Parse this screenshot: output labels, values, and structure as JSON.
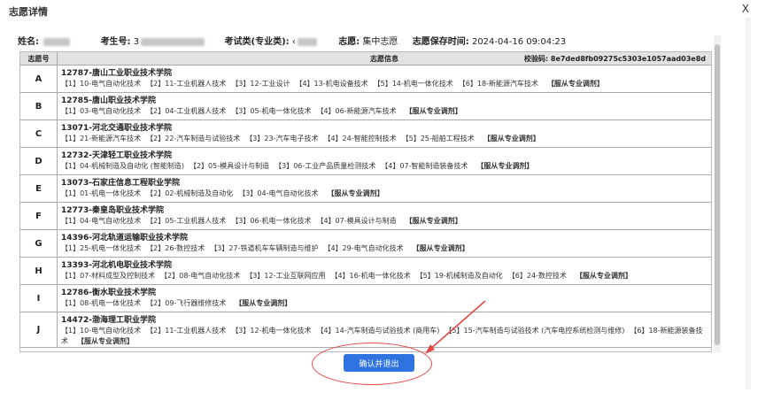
{
  "dialog": {
    "title": "志愿详情",
    "close_label": "X"
  },
  "info": {
    "name_label": "姓名:",
    "exam_no_label": "考生号:",
    "exam_no_partial": "3",
    "category_label": "考试类(专业类):",
    "category_partial": "‹",
    "mode_label": "志愿:",
    "mode_value": "集中志愿",
    "saved_label": "志愿保存时间:",
    "saved_value": "2024-04-16 09:04:23"
  },
  "table": {
    "col_no": "志愿号",
    "col_info": "志愿信息",
    "checksum_label": "校验码:",
    "checksum_value": "8e7ded8fb09275c5303e1057aad03e8d",
    "rows": [
      {
        "no": "A",
        "school": "12787-唐山工业职业技术学院",
        "majors": [
          "【1】10-电气自动化技术",
          "【2】11-工业机器人技术",
          "【3】12-工业设计",
          "【4】13-机电设备技术",
          "【5】14-机电一体化技术",
          "【6】18-新能源汽车技术"
        ],
        "adjust": "【服从专业调剂】"
      },
      {
        "no": "B",
        "school": "12785-唐山职业技术学院",
        "majors": [
          "【1】03-电气自动化技术",
          "【2】04-工业机器人技术",
          "【3】05-机电一体化技术",
          "【4】06-新能源汽车技术"
        ],
        "adjust": "【服从专业调剂】"
      },
      {
        "no": "C",
        "school": "13071-河北交通职业技术学院",
        "majors": [
          "【1】21-新能源汽车技术",
          "【2】22-汽车制造与试验技术",
          "【3】23-汽车电子技术",
          "【4】24-智能控制技术",
          "【5】25-船舶工程技术"
        ],
        "adjust": "【服从专业调剂】"
      },
      {
        "no": "D",
        "school": "12732-天津轻工职业技术学院",
        "majors": [
          "【1】04-机械制造及自动化 (智能制造)",
          "【2】05-模具设计与制造",
          "【3】06-工业产品质量检测技术",
          "【4】07-智能制造装备技术"
        ],
        "adjust": "【服从专业调剂】"
      },
      {
        "no": "E",
        "school": "13073-石家庄信息工程职业学院",
        "majors": [
          "【1】01-机电一体化技术",
          "【2】02-机械制造及自动化",
          "【3】04-电气自动化技术"
        ],
        "adjust": "【服从专业调剂】"
      },
      {
        "no": "F",
        "school": "12773-秦皇岛职业技术学院",
        "majors": [
          "【1】04-电气自动化技术",
          "【2】05-工业机器人技术",
          "【3】06-机电一体化技术",
          "【4】07-模具设计与制造"
        ],
        "adjust": "【服从专业调剂】"
      },
      {
        "no": "G",
        "school": "14396-河北轨道运输职业技术学院",
        "majors": [
          "【1】25-机电一体化技术",
          "【2】26-数控技术",
          "【3】27-铁道机车车辆制造与维护",
          "【4】29-电气自动化技术"
        ],
        "adjust": "【服从专业调剂】"
      },
      {
        "no": "H",
        "school": "13393-河北机电职业技术学院",
        "majors": [
          "【1】07-材料成型及控制技术",
          "【2】08-电气自动化技术",
          "【3】12-工业互联网应用",
          "【4】16-机电一体化技术",
          "【5】19-机械制造及自动化",
          "【6】24-数控技术"
        ],
        "adjust": "【服从专业调剂】"
      },
      {
        "no": "I",
        "school": "12786-衡水职业技术学院",
        "majors": [
          "【1】08-机电一体化技术",
          "【2】09-飞行器维修技术"
        ],
        "adjust": "【服从专业调剂】"
      },
      {
        "no": "J",
        "school": "14472-渤海理工职业学院",
        "majors": [
          "【1】10-电气自动化技术",
          "【2】11-工业机器人技术",
          "【3】12-机电一体化技术",
          "【4】14-汽车制造与试验技术 (商用车)",
          "【5】15-汽车制造与试验技术 (汽车电控系统检测与维修)",
          "【6】18-新能源装备技术"
        ],
        "adjust": "【服从专业调剂】"
      }
    ]
  },
  "confirm_button": "确认并退出",
  "annotation_color": "#e24a4a",
  "button_color": "#2f73e0"
}
